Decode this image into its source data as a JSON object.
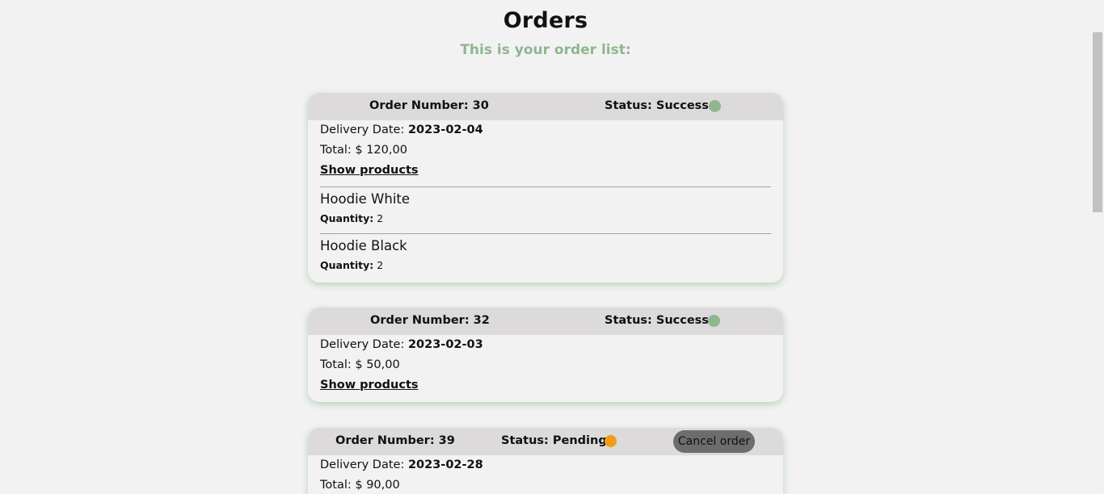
{
  "header": {
    "title": "Orders",
    "subtitle": "This is your order list:"
  },
  "colors": {
    "subtitle": "#8fb68f",
    "status_success": "#8fb68f",
    "status_pending": "#f39c12",
    "card_header": "#dcdada",
    "cancel_button": "#6d6d6d"
  },
  "orders": [
    {
      "number_label": "Order Number: 30",
      "status_label": "Status: Success",
      "status_color": "#8fb68f",
      "delivery_label": "Delivery Date:",
      "delivery_date": "2023-02-04",
      "total_label": "Total: $ 120,00",
      "show_products_label": "Show products",
      "products": [
        {
          "name": "Hoodie White",
          "quantity_label": "Quantity:",
          "quantity": "2"
        },
        {
          "name": "Hoodie Black",
          "quantity_label": "Quantity:",
          "quantity": "2"
        }
      ]
    },
    {
      "number_label": "Order Number: 32",
      "status_label": "Status: Success",
      "status_color": "#8fb68f",
      "delivery_label": "Delivery Date:",
      "delivery_date": "2023-02-03",
      "total_label": "Total: $ 50,00",
      "show_products_label": "Show products"
    },
    {
      "number_label": "Order Number: 39",
      "status_label": "Status: Pending",
      "status_color": "#f39c12",
      "cancel_label": "Cancel order",
      "delivery_label": "Delivery Date:",
      "delivery_date": "2023-02-28",
      "total_label": "Total: $ 90,00"
    }
  ]
}
